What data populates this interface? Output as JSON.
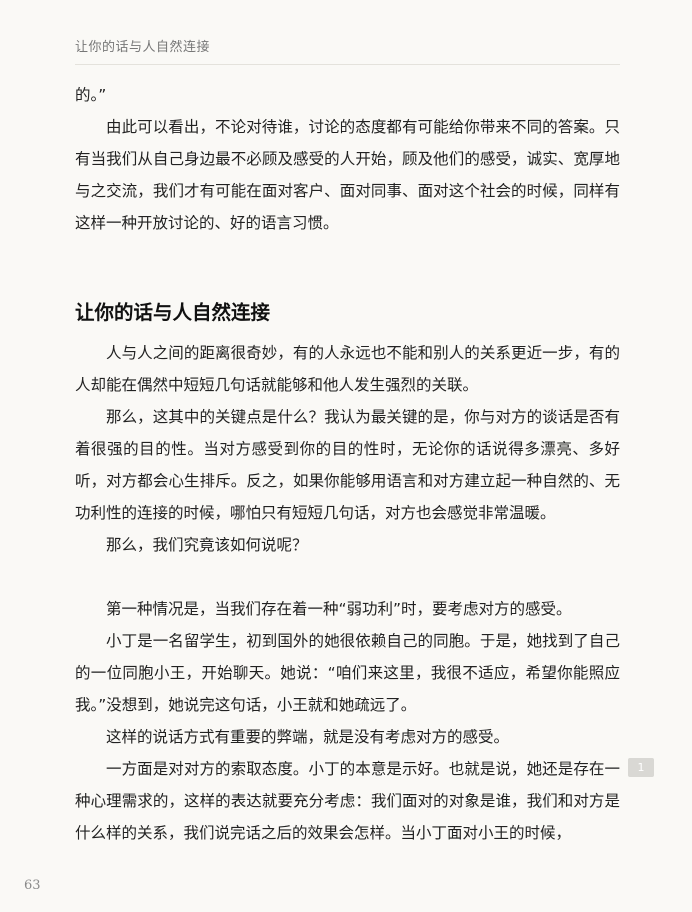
{
  "header": {
    "running_title": "让你的话与人自然连接"
  },
  "body": {
    "para_0": "的。”",
    "para_1": "由此可以看出，不论对待谁，讨论的态度都有可能给你带来不同的答案。只有当我们从自己身边最不必顾及感受的人开始，顾及他们的感受，诚实、宽厚地与之交流，我们才有可能在面对客户、面对同事、面对这个社会的时候，同样有这样一种开放讨论的、好的语言习惯。",
    "heading": "让你的话与人自然连接",
    "para_2": "人与人之间的距离很奇妙，有的人永远也不能和别人的关系更近一步，有的人却能在偶然中短短几句话就能够和他人发生强烈的关联。",
    "para_3": "那么，这其中的关键点是什么？我认为最关键的是，你与对方的谈话是否有着很强的目的性。当对方感受到你的目的性时，无论你的话说得多漂亮、多好听，对方都会心生排斥。反之，如果你能够用语言和对方建立起一种自然的、无功利性的连接的时候，哪怕只有短短几句话，对方也会感觉非常温暖。",
    "para_4": "那么，我们究竟该如何说呢？",
    "para_5": "第一种情况是，当我们存在着一种“弱功利”时，要考虑对方的感受。",
    "para_6": "小丁是一名留学生，初到国外的她很依赖自己的同胞。于是，她找到了自己的一位同胞小王，开始聊天。她说：“咱们来这里，我很不适应，希望你能照应我。”没想到，她说完这句话，小王就和她疏远了。",
    "para_7": "这样的说话方式有重要的弊端，就是没有考虑对方的感受。",
    "para_8": "一方面是对对方的索取态度。小丁的本意是示好。也就是说，她还是存在一种心理需求的，这样的表达就要充分考虑：我们面对的对象是谁，我们和对方是什么样的关系，我们说完话之后的效果会怎样。当小丁面对小王的时候，"
  },
  "sidebar": {
    "badge": "1"
  },
  "footer": {
    "page_number": "63"
  }
}
